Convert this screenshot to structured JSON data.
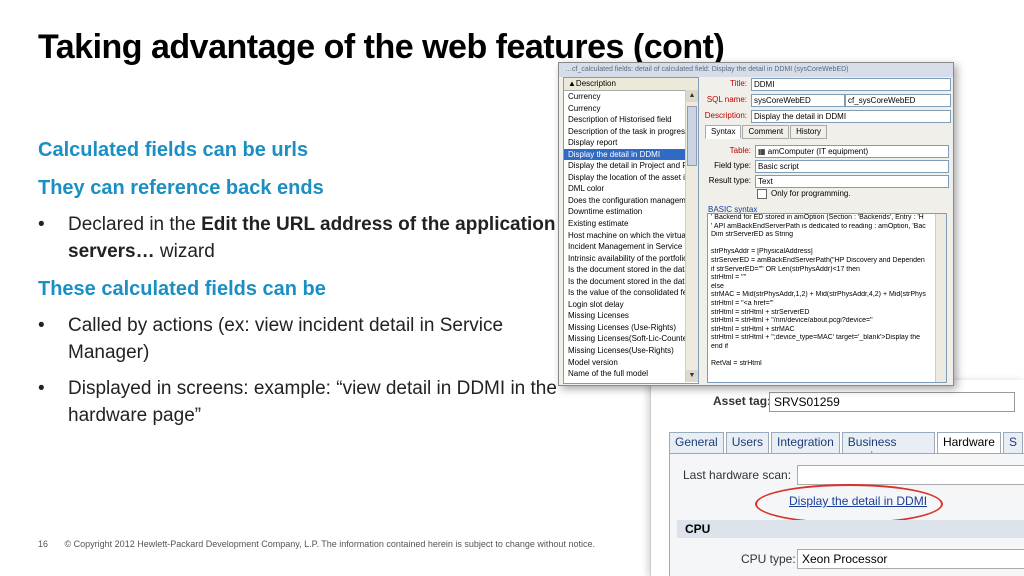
{
  "slide": {
    "title": "Taking advantage of the web features (cont)",
    "heading1": "Calculated fields can be urls",
    "heading2": "They can reference back ends",
    "bullet1_pre": "Declared in the ",
    "bullet1_bold": "Edit the URL address of the application servers…",
    "bullet1_post": " wizard",
    "heading3": "These calculated fields can be",
    "bullet2": "Called by actions (ex: view incident detail in Service Manager)",
    "bullet3": " Displayed  in screens: example: “view detail in DDMI in the hardware page”",
    "footer_page": "16",
    "footer_text": "© Copyright 2012 Hewlett-Packard Development Company, L.P.  The information contained herein is subject to change without notice."
  },
  "dialog": {
    "title_bar": "…cf_calculated fields: detail of calculated field: Display the detail in DDMI (sysCoreWebED)",
    "list_header": "▲Description",
    "list_items": [
      "Currency",
      "Currency",
      "Description of Historised field",
      "Description of the task in progress",
      "Display report",
      "Display the detail in DDMI",
      "Display the detail in Project and Po",
      "Display the location of the asset in",
      "DML color",
      "Does the configuration managemer",
      "Downtime estimation",
      "Existing estimate",
      "Host machine on which the virtual r",
      "Incident Management in Service M",
      "Intrinsic availability of the portfolio it",
      "Is the document stored in the datab",
      "Is the document stored in the datab",
      "Is the value of the consolidated fea",
      "Login slot delay",
      "Missing Licenses",
      "Missing Licenses (Use-Rights)",
      "Missing Licenses(Soft-Lic-Counter)",
      "Missing Licenses(Use-Rights)",
      "Model version",
      "Name of the full model"
    ],
    "selected_index": 5,
    "title_label": "Title:",
    "title_value": "DDMI",
    "sqlname_label": "SQL name:",
    "sqlname_value": "sysCoreWebED",
    "sqlname_value2": "cf_sysCoreWebED",
    "desc_label": "Description:",
    "desc_value": "Display the detail in DDMI",
    "tabs": [
      "Syntax",
      "Comment",
      "History"
    ],
    "table_label": "Table:",
    "table_value": "amComputer (IT equipment)",
    "fieldtype_label": "Field type:",
    "fieldtype_value": "Basic script",
    "resulttype_label": "Result type:",
    "resulttype_value": "Text",
    "only_prog_label": "Only for programming.",
    "basic_syntax_label": "BASIC syntax",
    "code_lines": [
      "' Backend for ED stored in amOption (Section : 'Backends', Entry : 'H",
      "' API amBackEndServerPath is dedicated to reading : amOption, 'Bac",
      "Dim strServerED as String",
      "",
      "strPhysAddr = [PhysicalAddress]",
      "strServerED = amBackEndServerPath(\"HP Discovery and Dependen",
      "if strServerED=\"\" OR Len(strPhysAddr)<17 then",
      "  strHtml = \"\"",
      "else",
      "  strMAC = Mid(strPhysAddr,1,2) + Mid(strPhysAddr,4,2) + Mid(strPhys",
      "  strHtml = \"<a href='\"",
      "  strHtml = strHtml + strServerED",
      "  strHtml = strHtml + \"/nm/device/about.pcgi?device=\"",
      "  strHtml = strHtml + strMAC",
      "  strHtml = strHtml + \";device_type=MAC' target='_blank'>Display the",
      "end if",
      "",
      "RetVal = strHtml"
    ]
  },
  "hardware": {
    "asset_tag_label": "Asset tag:",
    "asset_tag_value": "SRVS01259",
    "tabs": [
      "General",
      "Users",
      "Integration",
      "Business services",
      "Hardware",
      "S"
    ],
    "active_tab": 4,
    "last_scan_label": "Last hardware scan:",
    "ddmi_link": "Display the detail in DDMI",
    "cpu_section": "CPU",
    "cpu_type_label": "CPU type:",
    "cpu_type_value": "Xeon Processor"
  },
  "colors": {
    "heading_blue": "#1a8fc4",
    "highlight_ellipse": "#d8342b",
    "selection": "#316ac5"
  }
}
